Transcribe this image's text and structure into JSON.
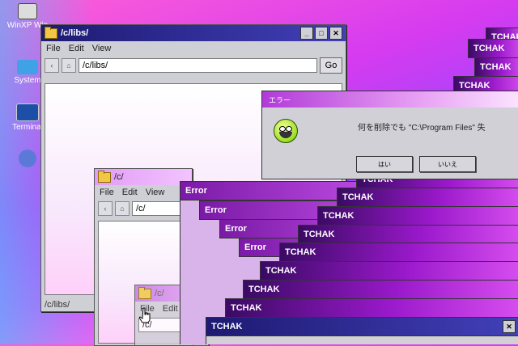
{
  "desktop": {
    "icons": [
      {
        "label": "WinXP Win",
        "icon": "computer-icon"
      },
      {
        "label": "System",
        "icon": "system-icon"
      },
      {
        "label": "Terminal",
        "icon": "terminal-icon"
      },
      {
        "label": "",
        "icon": "paint-icon"
      }
    ]
  },
  "windows": {
    "libs": {
      "title": "/c/libs/",
      "menu": [
        "File",
        "Edit",
        "View"
      ],
      "address": "/c/libs/",
      "go": "Go",
      "status": "/c/libs/"
    },
    "c": {
      "title": "/c/",
      "menu": [
        "File",
        "Edit",
        "View"
      ],
      "address": "/c/"
    },
    "c_small": {
      "title": "/c/",
      "menu": [
        "File",
        "Edit"
      ],
      "address": "/c/"
    }
  },
  "stack": {
    "errors": [
      "Error",
      "Error",
      "Error",
      "Error"
    ],
    "tchak": [
      "TCHAK",
      "TCHAK",
      "TCHAK",
      "TCHAK",
      "TCHAK",
      "TCHAK",
      "TCHAK",
      "TCHAK",
      "TCHAK",
      "TCHAK",
      "TCHAK",
      "TCHAK",
      "TCHAK",
      "TCHAK",
      "TCHAK",
      "TCHAK"
    ]
  },
  "dialog": {
    "title": "エラー",
    "message": "何を削除でも \"C:\\Program Files\" 失",
    "yes": "はい",
    "no": "いいえ"
  },
  "colors": {
    "accent": "#b81ad6",
    "title_blue": "#1d1a72"
  }
}
